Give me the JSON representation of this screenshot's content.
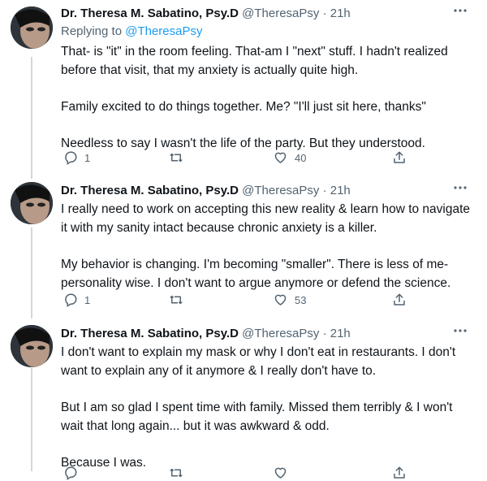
{
  "tweets": [
    {
      "name": "Dr. Theresa M. Sabatino, Psy.D",
      "handle": "@TheresaPsy",
      "separator": "·",
      "time": "21h",
      "replying_label": "Replying to",
      "replying_to": "@TheresaPsy",
      "paragraphs": [
        "That- is \"it\" in the room feeling. That-am I \"next\" stuff. I hadn't realized before that visit, that my anxiety is actually quite high.",
        "Family excited to do things together. Me? \"I'll just sit here, thanks\"",
        "Needless to say I wasn't the life of the party. But they understood."
      ],
      "replies": "1",
      "retweets": "",
      "likes": "40"
    },
    {
      "name": "Dr. Theresa M. Sabatino, Psy.D",
      "handle": "@TheresaPsy",
      "separator": "·",
      "time": "21h",
      "paragraphs": [
        "I really need to work on accepting this new reality & learn how to navigate it with my sanity intact because chronic anxiety is a killer.",
        "My behavior is changing. I'm becoming \"smaller\". There is less of me- personality wise. I don't want to argue anymore or defend the science."
      ],
      "replies": "1",
      "retweets": "",
      "likes": "53"
    },
    {
      "name": "Dr. Theresa M. Sabatino, Psy.D",
      "handle": "@TheresaPsy",
      "separator": "·",
      "time": "21h",
      "paragraphs": [
        "I don't want to explain my mask or why I don't eat in restaurants. I don't want to explain any of it anymore & I really don't have to.",
        "But I am so glad I spent time with family. Missed them terribly & I won't wait that long again... but it was awkward & odd.",
        "Because I was."
      ]
    }
  ],
  "icons": {
    "reply": "reply-icon",
    "retweet": "retweet-icon",
    "like": "heart-icon",
    "share": "share-icon",
    "more": "more-icon"
  },
  "colors": {
    "accent": "#1d9bf0",
    "secondary_text": "#536471",
    "thread_line": "#cfd9de"
  }
}
